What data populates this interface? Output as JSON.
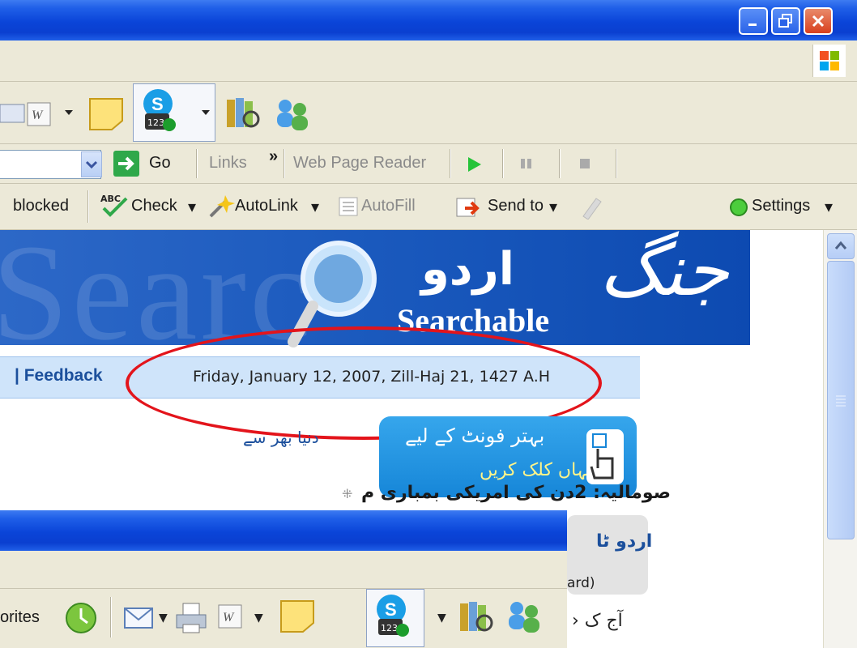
{
  "toolbar_links": {
    "go": "Go",
    "links": "Links",
    "links_chevron": "»",
    "web_page_reader": "Web Page Reader"
  },
  "google_toolbar": {
    "blocked": "blocked",
    "check": "Check",
    "autolink": "AutoLink",
    "autofill": "AutoFill",
    "send_to": "Send to",
    "settings": "Settings",
    "dropdown_glyph": "▾"
  },
  "banner": {
    "bg_word": "Searc",
    "urdu_word": "اردو",
    "searchable": "Searchable",
    "logo": "جنگ"
  },
  "datebar": {
    "feedback": "| Feedback",
    "date": "Friday, January 12, 2007, Zill-Haj 21, 1427 A.H"
  },
  "content": {
    "world_section": "دنیا بھر سے",
    "headline": "صومالیہ: 2دن کی امریکی بمباری م",
    "promo_line1": "بہتر فونٹ کے لیے",
    "promo_line2": "یہاں کلک کریں",
    "right_panel_title": "اردو ٹا",
    "right_panel_sub": "ard)",
    "right_panel_item": "› آج ک"
  },
  "window2": {
    "favorites_partial": "orites"
  },
  "colors": {
    "title_blue": "#0a44d8",
    "toolbar_bg": "#ece9d8",
    "annotation_red": "#e3141b"
  }
}
